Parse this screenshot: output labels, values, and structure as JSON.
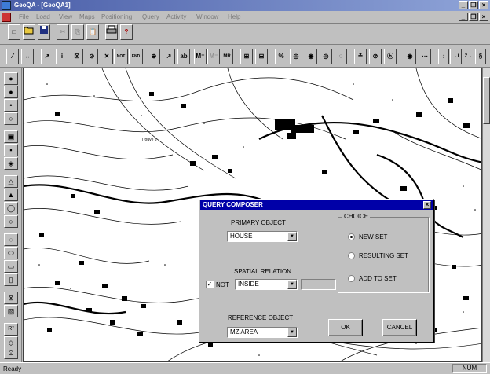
{
  "window": {
    "title": "GeoQA - [GeoQA1]",
    "minimize": "_",
    "maximize": "▫",
    "close": "×",
    "restore": "❐"
  },
  "menubar": {
    "items": [
      "File",
      "Load",
      "View",
      "Maps",
      "Positioning",
      "Query",
      "Activity",
      "Window",
      "Help"
    ]
  },
  "toolbar2": {
    "items": [
      "⁄",
      "↔",
      "↗",
      "i",
      "☒",
      "⊘",
      "✕",
      "NOT",
      "END",
      "⊕",
      "↗",
      "ab",
      "M⁺",
      "M⁻",
      "MR",
      "⊞",
      "⊟",
      "%",
      "◎",
      "◉",
      "◎",
      "◌",
      "≛",
      "⊘",
      "ⓑ",
      "◉",
      "⋯",
      "↕",
      "→I",
      "Z→",
      "§"
    ]
  },
  "toolbar1": {
    "items": [
      "□",
      "📂",
      "💾",
      "✂",
      "⎘",
      "📋",
      "🖨",
      "?"
    ]
  },
  "lefttoolbar": {
    "items": [
      "●",
      "●",
      "•",
      "○",
      "▣",
      "▪",
      "◈",
      "△",
      "▲",
      "◯",
      "○",
      "◌",
      "⬭",
      "▭",
      "▯",
      "⊠",
      "▧",
      "R²",
      "◇",
      "⊙"
    ]
  },
  "map": {
    "label": "Trouve 3"
  },
  "dialog": {
    "title": "QUERY COMPOSER",
    "close": "×",
    "primary_label": "PRIMARY OBJECT",
    "primary_value": "HOUSE",
    "spatial_label": "SPATIAL RELATION",
    "not_label": "NOT",
    "not_check": "✓",
    "spatial_value": "INSIDE",
    "reference_label": "REFERENCE OBJECT",
    "reference_value": "MZ AREA",
    "choice_label": "CHOICE",
    "choices": [
      "NEW SET",
      "RESULTING SET",
      "ADD TO SET"
    ],
    "ok": "OK",
    "cancel": "CANCEL",
    "arrow": "▼"
  },
  "statusbar": {
    "left": "Ready",
    "right": "NUM"
  }
}
